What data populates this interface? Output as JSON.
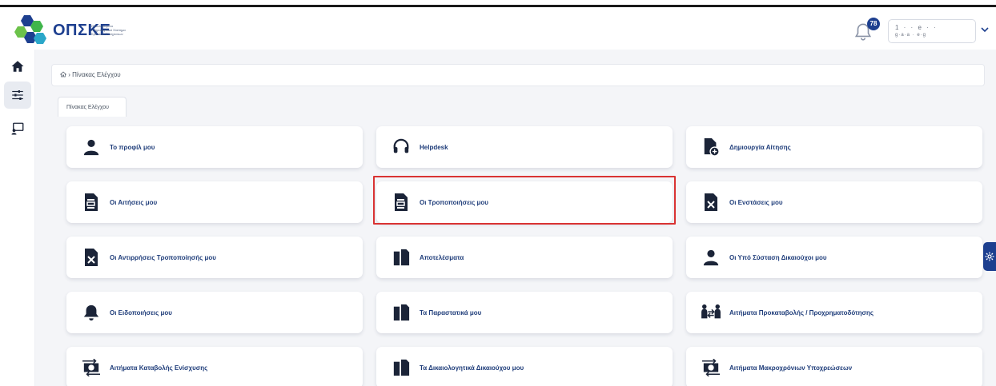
{
  "brand": {
    "logo_text": "ΟΠΣΚΕ",
    "logo_subtitle": "Ολοκληρωμένο Πληροφοριακό Σύστημα Κρατικών Ενισχύσεων",
    "brand_color": "#1d3f8f"
  },
  "header": {
    "notification_count": "78",
    "user_line1": "1 · · e · ·",
    "user_line2": "g·a·a · e·g"
  },
  "sidebar": {
    "items": [
      {
        "icon": "home-icon"
      },
      {
        "icon": "sliders-icon",
        "active": true
      },
      {
        "icon": "screen-user-icon"
      }
    ]
  },
  "breadcrumb": {
    "home_icon": "home-icon",
    "separator": "›",
    "current": "Πίνακας Ελέγχου"
  },
  "tab": {
    "label": "Πίνακας Ελέγχου"
  },
  "cards": [
    {
      "label": "Το προφίλ μου",
      "icon": "user-icon"
    },
    {
      "label": "Helpdesk",
      "icon": "headset-icon"
    },
    {
      "label": "Δημιουργία Αίτησης",
      "icon": "file-plus-icon"
    },
    {
      "label": "Οι Αιτήσεις μου",
      "icon": "document-icon"
    },
    {
      "label": "Οι Τροποποιήσεις μου",
      "icon": "document-icon"
    },
    {
      "label": "Οι Ενστάσεις μου",
      "icon": "file-x-icon"
    },
    {
      "label": "Οι Αντιρρήσεις Τροποποίησής μου",
      "icon": "file-x-icon"
    },
    {
      "label": "Αποτελέσματα",
      "icon": "files-copy-icon"
    },
    {
      "label": "Οι Υπό Σύσταση Δικαιούχοι μου",
      "icon": "user-icon"
    },
    {
      "label": "Οι Ειδοποιήσεις μου",
      "icon": "bell-icon"
    },
    {
      "label": "Τα Παραστατικά μου",
      "icon": "files-copy-icon"
    },
    {
      "label": "Αιτήματα Προκαταβολής / Προχρηματοδότησης",
      "icon": "people-exchange-icon"
    },
    {
      "label": "Αιτήματα Καταβολής Ενίσχυσης",
      "icon": "money-transfer-icon"
    },
    {
      "label": "Τα Δικαιολογητικά Δικαιούχου μου",
      "icon": "files-copy-icon"
    },
    {
      "label": "Αιτήματα Μακροχρόνιων Υποχρεώσεων",
      "icon": "money-transfer-icon"
    }
  ],
  "highlighted_card": "Οι Τροποποιήσεις μου",
  "colors": {
    "highlight_border": "#d93333",
    "icon_dark": "#1b2438",
    "label_blue": "#1f3d7a"
  }
}
